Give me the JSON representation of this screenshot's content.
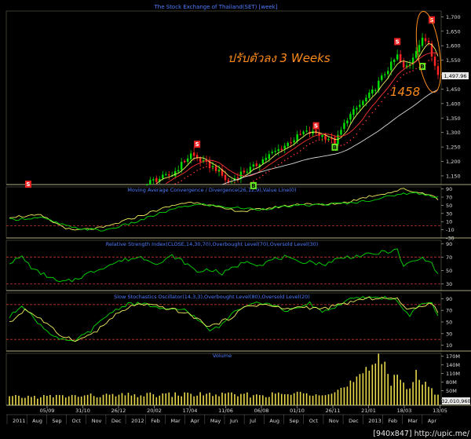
{
  "header": {
    "title": "The Stock Exchange of Thailand(SET) [week]",
    "annotation_thai": "ปรับตัวลง 3 Weeks",
    "annotation_level": "1458",
    "last_price_tag": "1,497.96",
    "volume_tag": "32,010,960",
    "watermark": "[940x847] http://upic.me/"
  },
  "colors": {
    "background": "#000000",
    "bull": "#00dd00",
    "bear": "#ff2222",
    "ma_fast": "#f0f060",
    "ma_slow": "#ff3333",
    "ma_long": "#d8d8d8",
    "title_text": "#4f7dff",
    "annotation": "#ff8c1a",
    "sell_signal": "#ee2222",
    "buy_signal": "#66ee22",
    "threshold_line": "#cc3333",
    "volume_bar": "#e8d84a"
  },
  "panels": {
    "price": {
      "ticks": [
        "1,700",
        "1,650",
        "1,600",
        "1,550",
        "1,500",
        "1,450",
        "1,400",
        "1,350",
        "1,300",
        "1,250",
        "1,200",
        "1,150"
      ],
      "signals": [
        {
          "label": "S",
          "type": "sell",
          "week": 6,
          "price": 1120
        },
        {
          "label": "S",
          "type": "sell",
          "week": 60,
          "price": 1258
        },
        {
          "label": "B",
          "type": "buy",
          "week": 78,
          "price": 1115
        },
        {
          "label": "S",
          "type": "sell",
          "week": 98,
          "price": 1322
        },
        {
          "label": "B",
          "type": "buy",
          "week": 104,
          "price": 1248
        },
        {
          "label": "S",
          "type": "sell",
          "week": 124,
          "price": 1613
        },
        {
          "label": "B",
          "type": "buy",
          "week": 132,
          "price": 1527
        },
        {
          "label": "S",
          "type": "sell",
          "week": 135,
          "price": 1688
        }
      ]
    },
    "macd": {
      "title": "Moving Average Convergence / Divergence(26,12,9),Value Line(0)",
      "ticks": [
        "90",
        "70",
        "50",
        "30",
        "10",
        "-10",
        "-30"
      ]
    },
    "rsi": {
      "title": "Relative Strength Index(CLOSE,14,30,70),Overbought Level(70),Oversold Level(30)",
      "ticks": [
        "90",
        "70",
        "50",
        "30"
      ]
    },
    "stoch": {
      "title": "Slow Stochastics Oscillator(14,3,3),Overbought Level(80),Oversold Level(20)",
      "ticks": [
        "90",
        "70",
        "50",
        "30",
        "10"
      ]
    },
    "volume": {
      "title": "Volume",
      "ticks": [
        "170M",
        "140M",
        "110M",
        "80M",
        "50M",
        "20M"
      ]
    }
  },
  "time_axis": {
    "upper": [
      "05/09",
      "31/10",
      "26/12",
      "20/02",
      "17/04",
      "11/06",
      "06/08",
      "01/10",
      "26/11",
      "21/01",
      "18/03",
      "13/05"
    ],
    "lower": [
      "2011",
      "Aug",
      "Sep",
      "Oct",
      "Nov",
      "Dec",
      "2012",
      "Feb",
      "Mar",
      "Apr",
      "May",
      "Jun",
      "Jul",
      "Aug",
      "Sep",
      "Oct",
      "Nov",
      "Dec",
      "2013",
      "Feb",
      "Mar",
      "Apr"
    ]
  },
  "chart_data": {
    "type": "candlestick",
    "title": "The Stock Exchange of Thailand(SET) [week]",
    "ylim": [
      1120,
      1720
    ],
    "price_anchors": [
      [
        0,
        1050
      ],
      [
        6,
        1105
      ],
      [
        12,
        1040
      ],
      [
        20,
        905
      ],
      [
        30,
        985
      ],
      [
        40,
        1060
      ],
      [
        45,
        1130
      ],
      [
        52,
        1155
      ],
      [
        58,
        1225
      ],
      [
        62,
        1195
      ],
      [
        66,
        1175
      ],
      [
        70,
        1125
      ],
      [
        74,
        1160
      ],
      [
        78,
        1180
      ],
      [
        82,
        1215
      ],
      [
        86,
        1240
      ],
      [
        90,
        1270
      ],
      [
        94,
        1300
      ],
      [
        98,
        1298
      ],
      [
        102,
        1280
      ],
      [
        104,
        1262
      ],
      [
        108,
        1350
      ],
      [
        112,
        1395
      ],
      [
        116,
        1440
      ],
      [
        120,
        1505
      ],
      [
        124,
        1565
      ],
      [
        126,
        1520
      ],
      [
        128,
        1540
      ],
      [
        130,
        1590
      ],
      [
        132,
        1620
      ],
      [
        134,
        1615
      ],
      [
        135,
        1572
      ],
      [
        136,
        1540
      ],
      [
        137,
        1498
      ]
    ],
    "indicator_anchors": {
      "macd": [
        [
          0,
          22
        ],
        [
          10,
          25
        ],
        [
          15,
          5
        ],
        [
          20,
          -12
        ],
        [
          30,
          -5
        ],
        [
          40,
          20
        ],
        [
          48,
          40
        ],
        [
          55,
          55
        ],
        [
          60,
          58
        ],
        [
          68,
          42
        ],
        [
          75,
          35
        ],
        [
          85,
          45
        ],
        [
          95,
          55
        ],
        [
          100,
          50
        ],
        [
          108,
          58
        ],
        [
          115,
          72
        ],
        [
          122,
          82
        ],
        [
          126,
          90
        ],
        [
          130,
          82
        ],
        [
          134,
          78
        ],
        [
          137,
          65
        ]
      ],
      "macd_signal": [
        [
          0,
          15
        ],
        [
          10,
          20
        ],
        [
          20,
          -5
        ],
        [
          30,
          -12
        ],
        [
          40,
          8
        ],
        [
          48,
          30
        ],
        [
          56,
          48
        ],
        [
          62,
          52
        ],
        [
          70,
          45
        ],
        [
          80,
          40
        ],
        [
          90,
          48
        ],
        [
          100,
          52
        ],
        [
          110,
          56
        ],
        [
          118,
          66
        ],
        [
          125,
          78
        ],
        [
          130,
          80
        ],
        [
          137,
          70
        ]
      ],
      "rsi": [
        [
          0,
          62
        ],
        [
          4,
          70
        ],
        [
          8,
          50
        ],
        [
          12,
          42
        ],
        [
          16,
          32
        ],
        [
          20,
          35
        ],
        [
          25,
          45
        ],
        [
          30,
          55
        ],
        [
          36,
          65
        ],
        [
          42,
          70
        ],
        [
          48,
          60
        ],
        [
          52,
          72
        ],
        [
          56,
          62
        ],
        [
          60,
          48
        ],
        [
          64,
          52
        ],
        [
          68,
          45
        ],
        [
          72,
          55
        ],
        [
          76,
          65
        ],
        [
          80,
          58
        ],
        [
          84,
          66
        ],
        [
          88,
          70
        ],
        [
          92,
          62
        ],
        [
          96,
          64
        ],
        [
          100,
          58
        ],
        [
          104,
          66
        ],
        [
          108,
          70
        ],
        [
          112,
          72
        ],
        [
          116,
          74
        ],
        [
          120,
          78
        ],
        [
          124,
          80
        ],
        [
          126,
          55
        ],
        [
          128,
          62
        ],
        [
          132,
          68
        ],
        [
          134,
          66
        ],
        [
          137,
          45
        ]
      ],
      "stoch_k": [
        [
          0,
          58
        ],
        [
          4,
          80
        ],
        [
          8,
          55
        ],
        [
          12,
          35
        ],
        [
          16,
          20
        ],
        [
          20,
          15
        ],
        [
          26,
          35
        ],
        [
          32,
          65
        ],
        [
          38,
          82
        ],
        [
          44,
          80
        ],
        [
          50,
          70
        ],
        [
          56,
          72
        ],
        [
          60,
          55
        ],
        [
          64,
          35
        ],
        [
          68,
          45
        ],
        [
          72,
          70
        ],
        [
          78,
          85
        ],
        [
          84,
          80
        ],
        [
          88,
          70
        ],
        [
          92,
          72
        ],
        [
          96,
          82
        ],
        [
          100,
          68
        ],
        [
          104,
          75
        ],
        [
          108,
          88
        ],
        [
          114,
          92
        ],
        [
          120,
          92
        ],
        [
          124,
          88
        ],
        [
          126,
          68
        ],
        [
          128,
          62
        ],
        [
          132,
          82
        ],
        [
          135,
          85
        ],
        [
          137,
          58
        ]
      ],
      "stoch_d": [
        [
          0,
          48
        ],
        [
          5,
          72
        ],
        [
          10,
          55
        ],
        [
          16,
          28
        ],
        [
          22,
          18
        ],
        [
          28,
          35
        ],
        [
          34,
          62
        ],
        [
          40,
          80
        ],
        [
          46,
          78
        ],
        [
          52,
          72
        ],
        [
          58,
          62
        ],
        [
          64,
          42
        ],
        [
          70,
          55
        ],
        [
          76,
          78
        ],
        [
          82,
          80
        ],
        [
          88,
          72
        ],
        [
          94,
          76
        ],
        [
          100,
          72
        ],
        [
          106,
          80
        ],
        [
          112,
          88
        ],
        [
          118,
          92
        ],
        [
          124,
          89
        ],
        [
          128,
          70
        ],
        [
          132,
          78
        ],
        [
          135,
          84
        ],
        [
          137,
          68
        ]
      ]
    },
    "volume_anchors": [
      [
        0,
        28
      ],
      [
        20,
        32
      ],
      [
        40,
        35
      ],
      [
        60,
        38
      ],
      [
        80,
        35
      ],
      [
        96,
        42
      ],
      [
        104,
        48
      ],
      [
        108,
        65
      ],
      [
        112,
        95
      ],
      [
        116,
        120
      ],
      [
        118,
        175
      ],
      [
        120,
        150
      ],
      [
        122,
        90
      ],
      [
        124,
        110
      ],
      [
        126,
        75
      ],
      [
        128,
        62
      ],
      [
        130,
        100
      ],
      [
        132,
        78
      ],
      [
        134,
        55
      ],
      [
        137,
        45
      ]
    ]
  }
}
